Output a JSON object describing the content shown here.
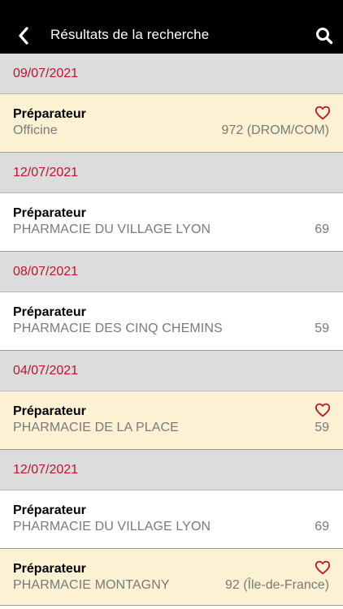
{
  "header": {
    "title": "Résultats de la recherche",
    "back_icon": "chevron-left-icon",
    "search_icon": "search-icon",
    "background": "#000000"
  },
  "colors": {
    "date_text": "#c0122c",
    "date_row_bg": "#dcdcdc",
    "favorite_row_bg": "#fdf1d3",
    "heart": "#c0122c",
    "subtitle": "#7a7a7a"
  },
  "results": [
    {
      "date": "09/07/2021",
      "title": "Préparateur",
      "pharmacy": "Officine",
      "location": "972 (DROM/COM)",
      "favorite": true
    },
    {
      "date": "12/07/2021",
      "title": "Préparateur",
      "pharmacy": "PHARMACIE DU VILLAGE LYON",
      "location": "69",
      "favorite": false
    },
    {
      "date": "08/07/2021",
      "title": "Préparateur",
      "pharmacy": "PHARMACIE DES CINQ CHEMINS",
      "location": "59",
      "favorite": false
    },
    {
      "date": "04/07/2021",
      "title": "Préparateur",
      "pharmacy": "PHARMACIE DE LA PLACE",
      "location": "59",
      "favorite": true
    },
    {
      "date": "12/07/2021",
      "title": "Préparateur",
      "pharmacy": "PHARMACIE DU VILLAGE LYON",
      "location": "69",
      "favorite": false
    },
    {
      "date": "",
      "title": "Préparateur",
      "pharmacy": "PHARMACIE MONTAGNY",
      "location": "92 (Île-de-France)",
      "favorite": true
    }
  ]
}
